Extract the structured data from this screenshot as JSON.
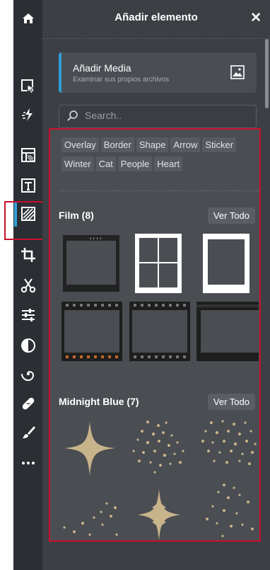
{
  "header": {
    "title": "Añadir elemento",
    "close_label": "✕"
  },
  "rail": {
    "icons": [
      "home-icon",
      "select-icon",
      "magic-icon",
      "layout-icon",
      "text-icon",
      "texture-icon",
      "crop-icon",
      "scissors-icon",
      "sliders-icon",
      "contrast-icon",
      "spiral-icon",
      "bandage-icon",
      "brush-icon",
      "more-icon"
    ]
  },
  "media": {
    "title": "Añadir Media",
    "subtitle": "Examinar sus propios archivos"
  },
  "search": {
    "placeholder": "Search.."
  },
  "tags": [
    "Overlay",
    "Border",
    "Shape",
    "Arrow",
    "Sticker",
    "Winter",
    "Cat",
    "People",
    "Heart"
  ],
  "sections": [
    {
      "title": "Film (8)",
      "button": "Ver Todo"
    },
    {
      "title": "Midnight Blue (7)",
      "button": "Ver Todo"
    }
  ],
  "colors": {
    "accent": "#2fa0d8",
    "highlight": "#c8102e",
    "gold": "#c8b48b"
  }
}
